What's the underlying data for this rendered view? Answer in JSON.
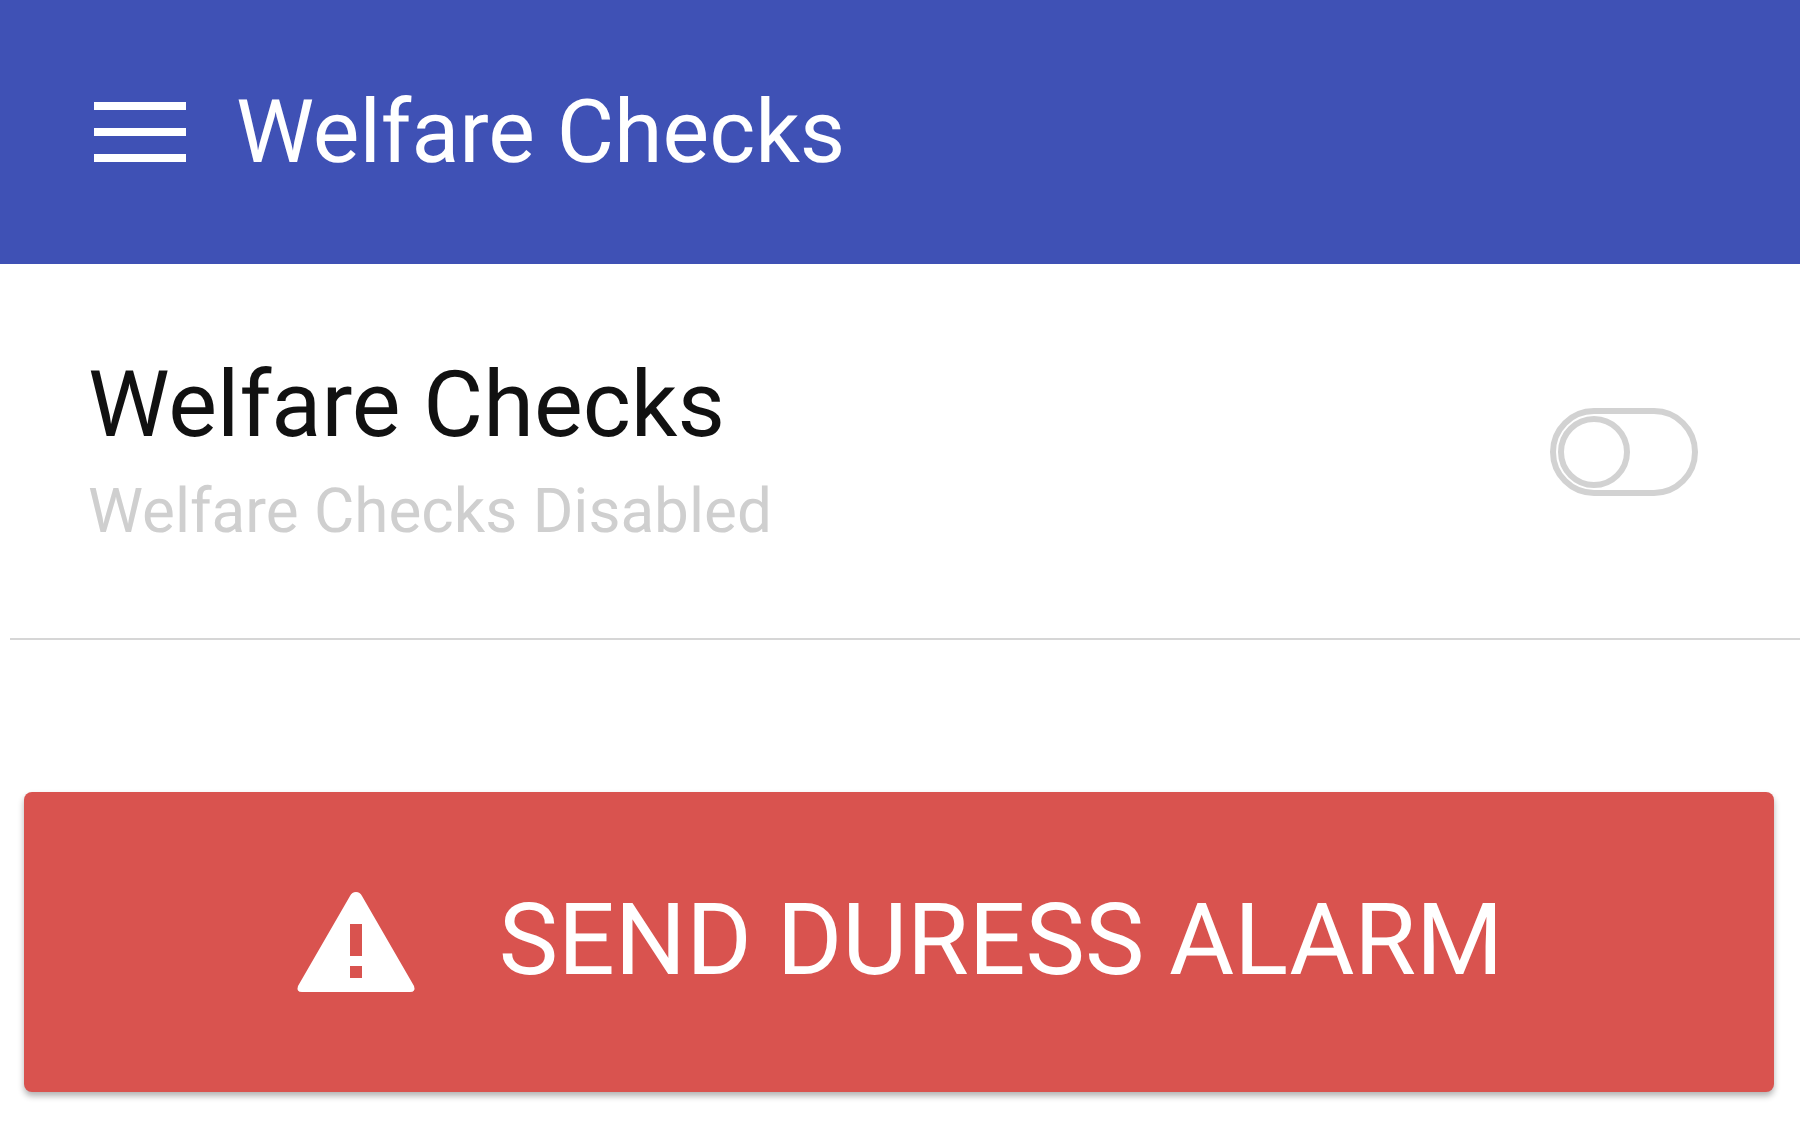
{
  "app_bar": {
    "title": "Welfare Checks"
  },
  "setting": {
    "title": "Welfare Checks",
    "subtitle": "Welfare Checks Disabled",
    "on": false
  },
  "alarm_button": {
    "label": "SEND DURESS ALARM"
  }
}
